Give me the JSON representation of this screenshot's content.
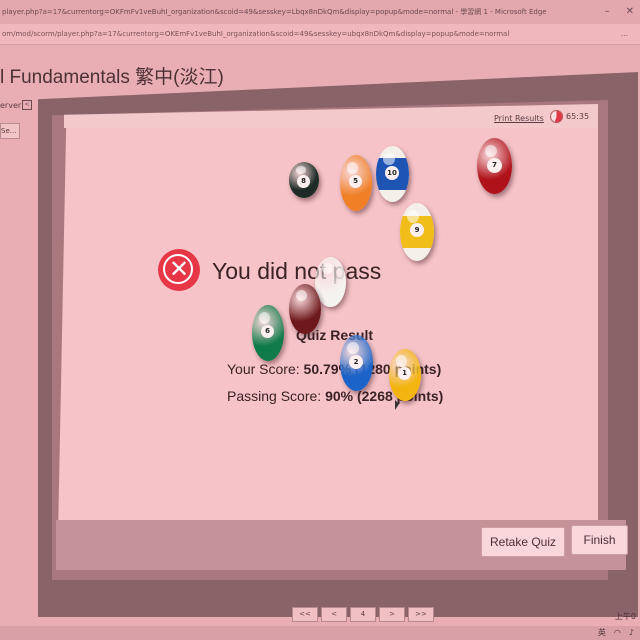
{
  "browser": {
    "title_fragment": "player.php?a=17&currentorg=OKFmFv1veBuhI_organization&scoid=49&sesskey=Lbqx8nDkQm&display=popup&mode=normal - 學習網 1 - Microsoft Edge",
    "address_fragment": "om/mod/scorm/player.php?a=17&currentorg=OKEmFv1veBuhI_organization&scoid=49&sesskey=ubqx8nDkQm&display=popup&mode=normal"
  },
  "course": {
    "title": "l Fundamentals 繁中(淡江)",
    "side_label": "erver",
    "side_toggle": "<",
    "side_button": "Se..."
  },
  "player": {
    "print_results": "Print Results",
    "timer": "65:35"
  },
  "quiz": {
    "fail_icon_glyph": "✕",
    "heading": "You did not pass",
    "result_label": "Quiz Result",
    "your_score_label": "Your Score:",
    "your_score_value": "50.79% (1280 points)",
    "passing_score_label": "Passing Score:",
    "passing_score_value": "90% (2268 points)"
  },
  "buttons": {
    "retake": "Retake Quiz",
    "finish": "Finish"
  },
  "pager": [
    "<<",
    "<",
    "4",
    ">",
    ">>"
  ],
  "tray": {
    "ime": "英",
    "clock": "上午0"
  },
  "balls": [
    {
      "id": "eight-ball",
      "number": "8",
      "color": "#1e2b26",
      "stripe": false
    },
    {
      "id": "orange-ball",
      "number": "5",
      "color": "#f07f26",
      "stripe": false
    },
    {
      "id": "blue-ball",
      "number": "10",
      "color": "#1e55b5",
      "stripe": true
    },
    {
      "id": "maroon-top",
      "number": "7",
      "color": "#b0121a",
      "stripe": false
    },
    {
      "id": "yellow-stripe",
      "number": "9",
      "color": "#f1bd18",
      "stripe": true
    },
    {
      "id": "cue-ball",
      "number": "",
      "color": "#f5f3ef",
      "stripe": false
    },
    {
      "id": "maroon-mid",
      "number": "",
      "color": "#6e1a1c",
      "stripe": false
    },
    {
      "id": "green-ball",
      "number": "6",
      "color": "#0f7a4a",
      "stripe": false
    },
    {
      "id": "blue-lower",
      "number": "2",
      "color": "#1b63c8",
      "stripe": false
    },
    {
      "id": "yellow-lower",
      "number": "1",
      "color": "#f2b40d",
      "stripe": false
    }
  ]
}
